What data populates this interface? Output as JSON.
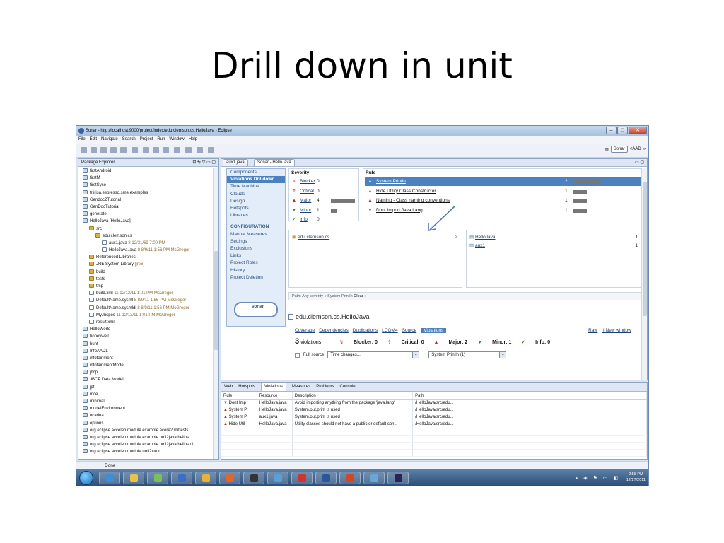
{
  "slide": {
    "title": "Drill down in unit"
  },
  "window": {
    "title": "Sonar - http://localhost:9000/project/index/edu.clemson.cs:HelloJava - Eclipse",
    "menu": [
      "File",
      "Edit",
      "Navigate",
      "Search",
      "Project",
      "Run",
      "Window",
      "Help"
    ],
    "perspective": {
      "sonar": "Sonar",
      "aad": "<AAD",
      "more": "»"
    }
  },
  "package_explorer": {
    "title": "Package Explorer",
    "items": [
      {
        "label": "firstAndroid",
        "meta": "",
        "type": "proj",
        "indent": 0
      },
      {
        "label": "firstM",
        "meta": "",
        "type": "proj",
        "indent": 0
      },
      {
        "label": "firstSyse",
        "meta": "",
        "type": "proj",
        "indent": 0
      },
      {
        "label": "fr.irisa.espresso.sme.examples",
        "meta": "",
        "type": "proj",
        "indent": 0
      },
      {
        "label": "Gendoc2Tutorial",
        "meta": "",
        "type": "proj",
        "indent": 0
      },
      {
        "label": "GenDocTutorial",
        "meta": "",
        "type": "proj",
        "indent": 0
      },
      {
        "label": "generate",
        "meta": "",
        "type": "proj",
        "indent": 0
      },
      {
        "label": "HelloJava [HelloJava]",
        "meta": "",
        "type": "proj",
        "indent": 0
      },
      {
        "label": "src",
        "meta": "",
        "type": "folder",
        "indent": 1
      },
      {
        "label": "edu.clemson.cs",
        "meta": "",
        "type": "folder",
        "indent": 2
      },
      {
        "label": "aux1.java",
        "meta": "8  12/31/69 7:00 PM",
        "type": "file",
        "indent": 3
      },
      {
        "label": "HelloJava.java",
        "meta": "8  8/9/11 1:56 PM  McGregor",
        "type": "file",
        "indent": 3
      },
      {
        "label": "Referenced Libraries",
        "meta": "",
        "type": "folder",
        "indent": 1
      },
      {
        "label": "JRE System Library",
        "meta": "[jre6]",
        "type": "folder",
        "indent": 1
      },
      {
        "label": "build",
        "meta": "",
        "type": "folder",
        "indent": 1
      },
      {
        "label": "tests",
        "meta": "",
        "type": "folder",
        "indent": 1
      },
      {
        "label": "tmp",
        "meta": "",
        "type": "folder",
        "indent": 1
      },
      {
        "label": "build.xml",
        "meta": "11  12/13/11 1:01 PM  McGregor",
        "type": "file",
        "indent": 1
      },
      {
        "label": "DefaultName.sysml",
        "meta": "8  8/9/11 1:56 PM  McGregor",
        "type": "file",
        "indent": 1
      },
      {
        "label": "DefaultName.sysmldi",
        "meta": "8  8/9/11 1:56 PM  McGregor",
        "type": "file",
        "indent": 1
      },
      {
        "label": "My.mspec",
        "meta": "11  12/13/11 1:01 PM  McGregor",
        "type": "file",
        "indent": 1
      },
      {
        "label": "result.xml",
        "meta": "",
        "type": "file",
        "indent": 1
      },
      {
        "label": "HelloWorld",
        "meta": "",
        "type": "proj",
        "indent": 0
      },
      {
        "label": "honeywell",
        "meta": "",
        "type": "proj",
        "indent": 0
      },
      {
        "label": "hunt",
        "meta": "",
        "type": "proj",
        "indent": 0
      },
      {
        "label": "InfoAADL",
        "meta": "",
        "type": "proj",
        "indent": 0
      },
      {
        "label": "infotainment",
        "meta": "",
        "type": "proj",
        "indent": 0
      },
      {
        "label": "infotainmentModel",
        "meta": "",
        "type": "proj",
        "indent": 0
      },
      {
        "label": "jbcp",
        "meta": "",
        "type": "proj",
        "indent": 0
      },
      {
        "label": "JBCP Data Model",
        "meta": "",
        "type": "proj",
        "indent": 0
      },
      {
        "label": "jpf",
        "meta": "",
        "type": "proj",
        "indent": 0
      },
      {
        "label": "mce",
        "meta": "",
        "type": "proj",
        "indent": 0
      },
      {
        "label": "minimal",
        "meta": "",
        "type": "proj",
        "indent": 0
      },
      {
        "label": "modelEnvironment",
        "meta": "",
        "type": "proj",
        "indent": 0
      },
      {
        "label": "ocarina",
        "meta": "",
        "type": "proj",
        "indent": 0
      },
      {
        "label": "options",
        "meta": "",
        "type": "proj",
        "indent": 0
      },
      {
        "label": "org.eclipse.acceleo.module.example.ecore2unittests",
        "meta": "",
        "type": "proj",
        "indent": 0
      },
      {
        "label": "org.eclipse.acceleo.module.example.uml2java.helios",
        "meta": "",
        "type": "proj",
        "indent": 0
      },
      {
        "label": "org.eclipse.acceleo.module.example.uml2java.helios.ui",
        "meta": "",
        "type": "proj",
        "indent": 0
      },
      {
        "label": "org.eclipse.acceleo.module.uml2xtext",
        "meta": "",
        "type": "proj",
        "indent": 0
      }
    ]
  },
  "editor": {
    "tabs": [
      "aux1.java",
      "Sonar - HelloJava"
    ],
    "nav": {
      "items": [
        "Components",
        "Violations Drilldown",
        "Time Machine",
        "Clouds",
        "Design",
        "Hotspots",
        "Libraries"
      ],
      "config_header": "CONFIGURATION",
      "config_items": [
        "Manual Measures",
        "Settings",
        "Exclusions",
        "Links",
        "Project Roles",
        "History",
        "Project Deletion"
      ],
      "logo": "sonar"
    },
    "severity": {
      "header": "Severity",
      "rows": [
        {
          "label": "Blocker",
          "count": "0",
          "icon": "↯",
          "color": "#d9372b",
          "fill": 0
        },
        {
          "label": "Critical",
          "count": "0",
          "icon": "⇮",
          "color": "#c0281e",
          "fill": 0
        },
        {
          "label": "Major",
          "count": "4",
          "icon": "▲",
          "color": "#c0281e",
          "fill": 1
        },
        {
          "label": "Minor",
          "count": "1",
          "icon": "▼",
          "color": "#2e8b2e",
          "fill": 0.25
        },
        {
          "label": "Info",
          "count": "0",
          "icon": "✔",
          "color": "#2e8b2e",
          "fill": 0
        }
      ]
    },
    "rules": {
      "header": "Rule",
      "rows": [
        {
          "label": "System Println",
          "count": "2",
          "icon": "▲",
          "color": "#c0281e",
          "fill": 1
        },
        {
          "label": "Hide Utility Class Constructor",
          "count": "1",
          "icon": "▲",
          "color": "#c0281e",
          "fill": 0.5
        },
        {
          "label": "Naming - Class naming conventions",
          "count": "1",
          "icon": "▲",
          "color": "#c0281e",
          "fill": 0.5
        },
        {
          "label": "Dont Import Java Lang",
          "count": "1",
          "icon": "▼",
          "color": "#2e8b2e",
          "fill": 0.5
        }
      ]
    },
    "packages": [
      {
        "label": "edu.clemson.cs",
        "count": "2"
      }
    ],
    "classes": [
      {
        "label": "HelloJava",
        "count": "1"
      },
      {
        "label": "aux1",
        "count": "1"
      }
    ],
    "path": {
      "label": "Path:",
      "severity": "Any severity",
      "sep": "»",
      "rule": "System Println",
      "clear": "Clear"
    },
    "resource": {
      "title": "edu.clemson.cs.HelloJava",
      "tabs": [
        "Coverage",
        "Dependencies",
        "Duplications",
        "LCOM4",
        "Source",
        "Violations"
      ],
      "raw": "Raw",
      "new_window": "New window",
      "violations_count": "3",
      "violations_label": "violations",
      "blocker": "Blocker: 0",
      "critical": "Critical: 0",
      "major": "Major: 2",
      "minor": "Minor: 1",
      "info": "Info: 0",
      "full_source": "Full source",
      "time_select": "Time changes...",
      "rule_select": "System Println (1)"
    }
  },
  "bottom": {
    "tabs": [
      "Web",
      "Hotspots",
      "Violations",
      "Measures",
      "Problems",
      "Console"
    ],
    "columns": [
      "Rule",
      "Resource",
      "Description",
      "Path"
    ],
    "rows": [
      {
        "rule": "Dont Imp",
        "resource": "HelloJava.java",
        "description": "Avoid importing anything from the package 'java.lang'",
        "path": "/HelloJava/src/edu...",
        "icon": "▼",
        "color": "#2e8b2e"
      },
      {
        "rule": "System P",
        "resource": "HelloJava.java",
        "description": "System.out.print is used",
        "path": "/HelloJava/src/edu...",
        "icon": "▲",
        "color": "#c0281e"
      },
      {
        "rule": "System P",
        "resource": "aux1.java",
        "description": "System.out.print is used",
        "path": "/HelloJava/src/edu...",
        "icon": "▲",
        "color": "#c0281e"
      },
      {
        "rule": "Hide Util",
        "resource": "HelloJava.java",
        "description": "Utility classes should not have a public or default con...",
        "path": "/HelloJava/src/edu...",
        "icon": "▲",
        "color": "#c0281e"
      }
    ]
  },
  "status": {
    "text": "Done"
  },
  "clock": {
    "time": "2:58 PM",
    "date": "12/27/2011"
  }
}
